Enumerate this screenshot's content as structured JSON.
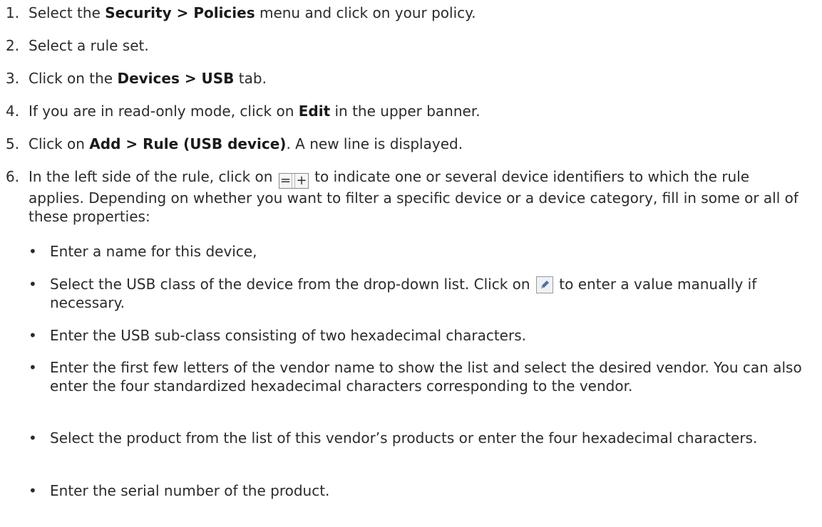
{
  "steps": [
    {
      "num": "1.",
      "parts": [
        "Select the ",
        "Security > Policies",
        " menu and click on your policy."
      ]
    },
    {
      "num": "2.",
      "parts": [
        "Select a rule set."
      ]
    },
    {
      "num": "3.",
      "parts": [
        "Click on the ",
        "Devices > USB",
        " tab."
      ]
    },
    {
      "num": "4.",
      "parts": [
        "If you are in read-only mode, click on ",
        "Edit",
        " in the upper banner."
      ]
    },
    {
      "num": "5.",
      "parts": [
        "Click on ",
        "Add > Rule (USB device)",
        ". A new line is displayed."
      ]
    },
    {
      "num": "6.",
      "parts": [
        "In the left side of the rule, click on ",
        " to indicate one or several device identifiers to which the rule applies. Depending on whether you want to filter a specific device or a device category, fill in some or all of these properties:"
      ]
    }
  ],
  "icons": {
    "identifier_icon": {
      "name": "equals-plus-icon",
      "left_glyph": "=",
      "right_glyph": "+"
    },
    "edit_icon": {
      "name": "pencil-edit-icon",
      "color": "#4a6fa5"
    }
  },
  "bullets": [
    {
      "mark": "•",
      "text": "Enter a name for this device,"
    },
    {
      "mark": "•",
      "parts": [
        "Select the USB class of the device from the drop-down list. Click on ",
        " to enter a value manually if necessary."
      ]
    },
    {
      "mark": "•",
      "text": "Enter the USB sub-class consisting of two hexadecimal characters."
    },
    {
      "mark": "•",
      "text": "Enter the first few letters of the vendor name to show the list and select the desired vendor. You can also enter the four standardized hexadecimal characters corresponding to the vendor."
    },
    {
      "mark": "•",
      "text": "Select the product from the list of this vendor’s products or enter the four hexadecimal characters."
    },
    {
      "mark": "•",
      "text": "Enter the serial number of the product."
    }
  ]
}
